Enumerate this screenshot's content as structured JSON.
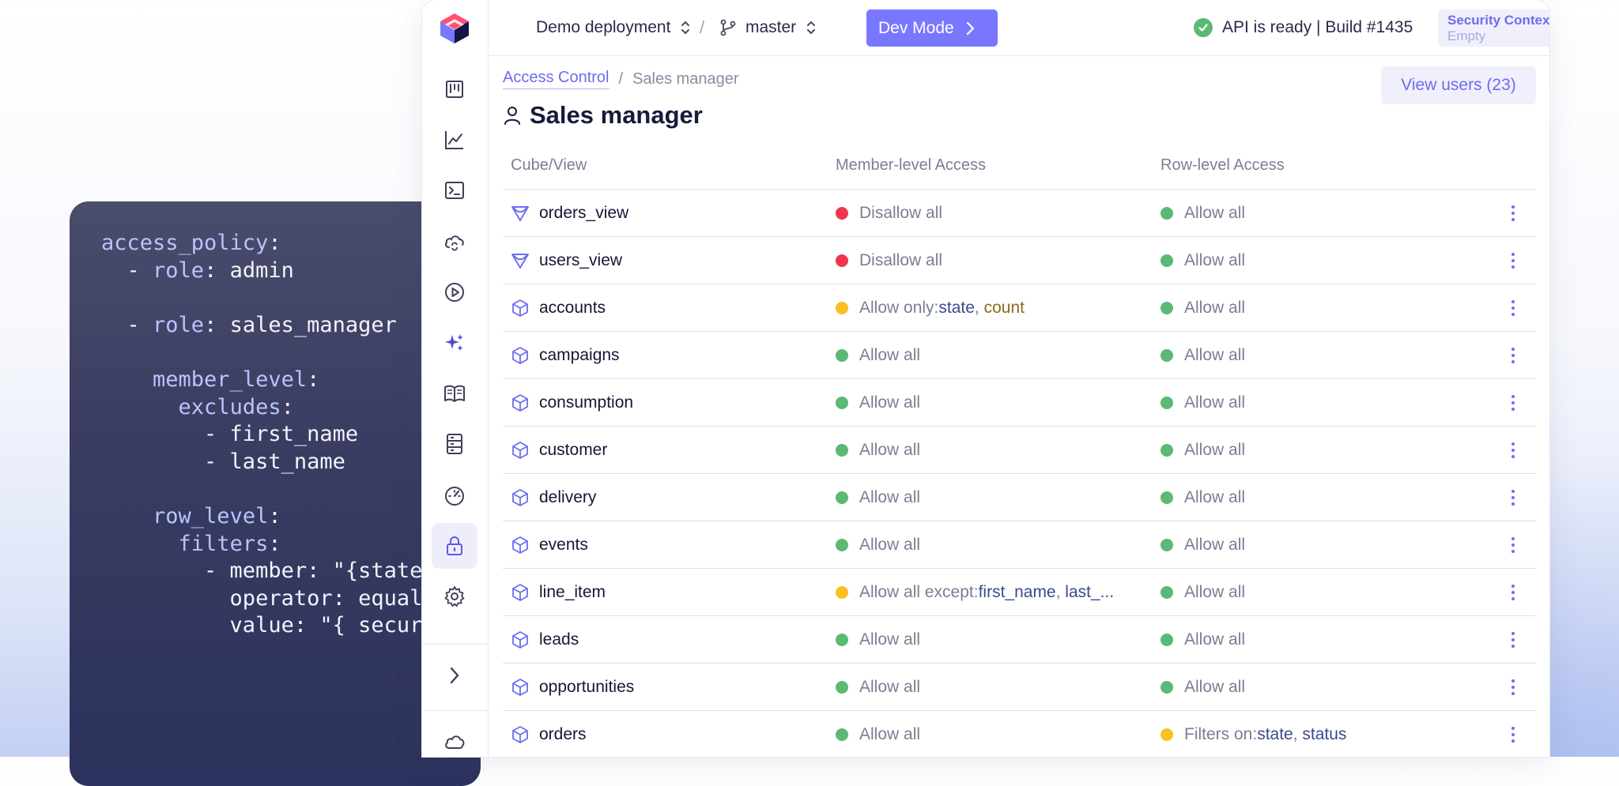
{
  "code": {
    "lines": [
      [
        {
          "t": "access_policy",
          "k": true
        },
        {
          "t": ":"
        }
      ],
      [
        {
          "t": "  - "
        },
        {
          "t": "role",
          "k": true
        },
        {
          "t": ": admin"
        }
      ],
      [
        {
          "t": ""
        }
      ],
      [
        {
          "t": "  - "
        },
        {
          "t": "role",
          "k": true
        },
        {
          "t": ": sales_manager"
        }
      ],
      [
        {
          "t": ""
        }
      ],
      [
        {
          "t": "    "
        },
        {
          "t": "member_level",
          "k": true
        },
        {
          "t": ":"
        }
      ],
      [
        {
          "t": "      "
        },
        {
          "t": "excludes",
          "k": true
        },
        {
          "t": ":"
        }
      ],
      [
        {
          "t": "        - first_name"
        }
      ],
      [
        {
          "t": "        - last_name"
        }
      ],
      [
        {
          "t": ""
        }
      ],
      [
        {
          "t": "    "
        },
        {
          "t": "row_level",
          "k": true
        },
        {
          "t": ":"
        }
      ],
      [
        {
          "t": "      "
        },
        {
          "t": "filters",
          "k": true
        },
        {
          "t": ":"
        }
      ],
      [
        {
          "t": "        - member: \"{state}"
        }
      ],
      [
        {
          "t": "          operator: equals"
        }
      ],
      [
        {
          "t": "          value: \"{ secur"
        }
      ]
    ]
  },
  "topbar": {
    "deployment": "Demo deployment",
    "separator": "/",
    "branch": "master",
    "dev_mode_label": "Dev Mode",
    "api_status": "API is ready | Build #1435",
    "security_context_title": "Security Context",
    "security_context_value": "Empty"
  },
  "sidebar": {
    "items": [
      {
        "name": "kanban-icon",
        "active": false
      },
      {
        "name": "chart-line-icon",
        "active": false
      },
      {
        "name": "terminal-icon",
        "active": false
      },
      {
        "name": "cloud-sync-icon",
        "active": false
      },
      {
        "name": "play-circle-icon",
        "active": false
      },
      {
        "name": "sparkles-icon",
        "active": false
      },
      {
        "name": "book-icon",
        "active": false
      },
      {
        "name": "server-icon",
        "active": false
      },
      {
        "name": "gauge-icon",
        "active": false
      },
      {
        "name": "lock-icon",
        "active": true
      },
      {
        "name": "gear-icon",
        "active": false
      },
      {
        "name": "chevron-right-icon",
        "active": false
      },
      {
        "name": "cloud-icon",
        "active": false
      }
    ]
  },
  "breadcrumb": {
    "parent": "Access Control",
    "separator": "/",
    "current": "Sales manager"
  },
  "view_users_label": "View users (23)",
  "page_title": "Sales manager",
  "table": {
    "headers": [
      "Cube/View",
      "Member-level Access",
      "Row-level Access"
    ],
    "rows": [
      {
        "type": "view",
        "name": "orders_view",
        "member": {
          "status": "red",
          "text": "Disallow all",
          "fields": []
        },
        "row": {
          "status": "green",
          "text": "Allow all",
          "fields": []
        }
      },
      {
        "type": "view",
        "name": "users_view",
        "member": {
          "status": "red",
          "text": "Disallow all",
          "fields": []
        },
        "row": {
          "status": "green",
          "text": "Allow all",
          "fields": []
        }
      },
      {
        "type": "cube",
        "name": "accounts",
        "member": {
          "status": "yellow",
          "text": "Allow only: ",
          "fields": [
            {
              "t": "state",
              "c": "f1"
            },
            {
              "t": ", ",
              "c": ""
            },
            {
              "t": "count",
              "c": "f2"
            }
          ]
        },
        "row": {
          "status": "green",
          "text": "Allow all",
          "fields": []
        }
      },
      {
        "type": "cube",
        "name": "campaigns",
        "member": {
          "status": "green",
          "text": "Allow all",
          "fields": []
        },
        "row": {
          "status": "green",
          "text": "Allow all",
          "fields": []
        }
      },
      {
        "type": "cube",
        "name": "consumption",
        "member": {
          "status": "green",
          "text": "Allow all",
          "fields": []
        },
        "row": {
          "status": "green",
          "text": "Allow all",
          "fields": []
        }
      },
      {
        "type": "cube",
        "name": "customer",
        "member": {
          "status": "green",
          "text": "Allow all",
          "fields": []
        },
        "row": {
          "status": "green",
          "text": "Allow all",
          "fields": []
        }
      },
      {
        "type": "cube",
        "name": "delivery",
        "member": {
          "status": "green",
          "text": "Allow all",
          "fields": []
        },
        "row": {
          "status": "green",
          "text": "Allow all",
          "fields": []
        }
      },
      {
        "type": "cube",
        "name": "events",
        "member": {
          "status": "green",
          "text": "Allow all",
          "fields": []
        },
        "row": {
          "status": "green",
          "text": "Allow all",
          "fields": []
        }
      },
      {
        "type": "cube",
        "name": "line_item",
        "member": {
          "status": "yellow",
          "text": "Allow all except: ",
          "fields": [
            {
              "t": "first_name",
              "c": "f1"
            },
            {
              "t": ", ",
              "c": ""
            },
            {
              "t": "last_...",
              "c": "f1"
            }
          ]
        },
        "row": {
          "status": "green",
          "text": "Allow all",
          "fields": []
        }
      },
      {
        "type": "cube",
        "name": "leads",
        "member": {
          "status": "green",
          "text": "Allow all",
          "fields": []
        },
        "row": {
          "status": "green",
          "text": "Allow all",
          "fields": []
        }
      },
      {
        "type": "cube",
        "name": "opportunities",
        "member": {
          "status": "green",
          "text": "Allow all",
          "fields": []
        },
        "row": {
          "status": "green",
          "text": "Allow all",
          "fields": []
        }
      },
      {
        "type": "cube",
        "name": "orders",
        "member": {
          "status": "green",
          "text": "Allow all",
          "fields": []
        },
        "row": {
          "status": "yellow",
          "text": "Filters on: ",
          "fields": [
            {
              "t": "state",
              "c": "f1"
            },
            {
              "t": ", ",
              "c": ""
            },
            {
              "t": "status",
              "c": "f1"
            }
          ]
        }
      }
    ]
  },
  "colors": {
    "accent": "#7a77ff",
    "status_green": "#5bb974",
    "status_red": "#f0364f",
    "status_yellow": "#fac021"
  }
}
